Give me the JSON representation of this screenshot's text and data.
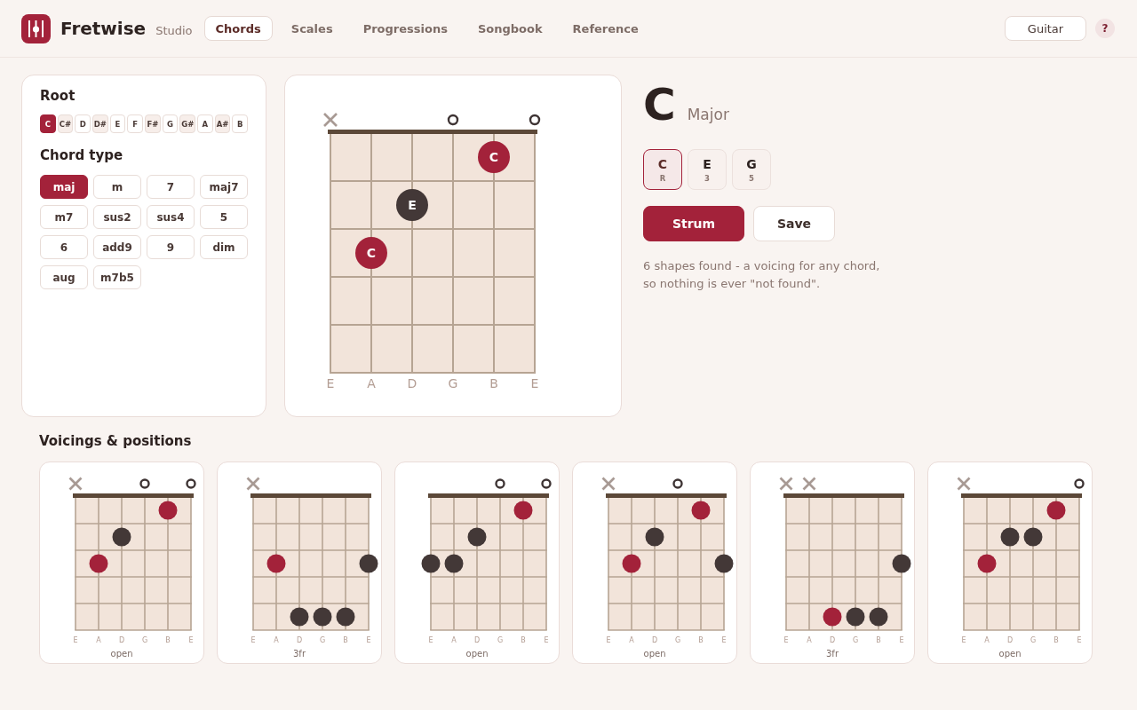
{
  "app": {
    "name": "Fretwise",
    "edition": "Studio"
  },
  "tabs": [
    {
      "label": "Chords",
      "selected": true
    },
    {
      "label": "Scales",
      "selected": false
    },
    {
      "label": "Progressions",
      "selected": false
    },
    {
      "label": "Songbook",
      "selected": false
    },
    {
      "label": "Reference",
      "selected": false
    }
  ],
  "instrument": {
    "label": "Guitar"
  },
  "help": {
    "label": "?"
  },
  "root_picker": {
    "title": "Root",
    "roots": [
      {
        "label": "C",
        "kind": "natural",
        "selected": true
      },
      {
        "label": "C#",
        "kind": "sharp",
        "selected": false
      },
      {
        "label": "D",
        "kind": "natural",
        "selected": false
      },
      {
        "label": "D#",
        "kind": "sharp",
        "selected": false
      },
      {
        "label": "E",
        "kind": "natural",
        "selected": false
      },
      {
        "label": "F",
        "kind": "natural",
        "selected": false
      },
      {
        "label": "F#",
        "kind": "sharp",
        "selected": false
      },
      {
        "label": "G",
        "kind": "natural",
        "selected": false
      },
      {
        "label": "G#",
        "kind": "sharp",
        "selected": false
      },
      {
        "label": "A",
        "kind": "natural",
        "selected": false
      },
      {
        "label": "A#",
        "kind": "sharp",
        "selected": false
      },
      {
        "label": "B",
        "kind": "natural",
        "selected": false
      }
    ]
  },
  "chord_type": {
    "title": "Chord type",
    "types": [
      {
        "label": "maj",
        "selected": true
      },
      {
        "label": "m",
        "selected": false
      },
      {
        "label": "7",
        "selected": false
      },
      {
        "label": "maj7",
        "selected": false
      },
      {
        "label": "m7",
        "selected": false
      },
      {
        "label": "sus2",
        "selected": false
      },
      {
        "label": "sus4",
        "selected": false
      },
      {
        "label": "5",
        "selected": false
      },
      {
        "label": "6",
        "selected": false
      },
      {
        "label": "add9",
        "selected": false
      },
      {
        "label": "9",
        "selected": false
      },
      {
        "label": "dim",
        "selected": false
      },
      {
        "label": "aug",
        "selected": false
      },
      {
        "label": "m7b5",
        "selected": false
      }
    ]
  },
  "diagram": {
    "strings": [
      {
        "label": "E",
        "muted": true,
        "open": false,
        "frets": [
          false,
          false,
          false,
          false,
          false
        ]
      },
      {
        "label": "A",
        "muted": false,
        "open": false,
        "frets": [
          false,
          false,
          true,
          false,
          false
        ],
        "color": "#a3223a",
        "note": "C"
      },
      {
        "label": "D",
        "muted": false,
        "open": false,
        "frets": [
          false,
          true,
          false,
          false,
          false
        ],
        "color": "#433837",
        "note": "E"
      },
      {
        "label": "G",
        "muted": false,
        "open": true,
        "frets": [
          false,
          false,
          false,
          false,
          false
        ]
      },
      {
        "label": "B",
        "muted": false,
        "open": false,
        "frets": [
          true,
          false,
          false,
          false,
          false
        ],
        "color": "#a3223a",
        "note": "C"
      },
      {
        "label": "E",
        "muted": false,
        "open": true,
        "frets": [
          false,
          false,
          false,
          false,
          false
        ]
      }
    ]
  },
  "chord": {
    "symbol": "C",
    "quality": "Major",
    "notes": [
      {
        "note": "C",
        "degree": "R",
        "selected": true
      },
      {
        "note": "E",
        "degree": "3",
        "selected": false
      },
      {
        "note": "G",
        "degree": "5",
        "selected": false
      }
    ],
    "actions": [
      {
        "label": "Strum",
        "kind": "primary"
      },
      {
        "label": "Save",
        "kind": "secondary"
      }
    ],
    "summary": "6 shapes found - a voicing for any chord, so nothing is ever \"not found\"."
  },
  "voicings": {
    "title": "Voicings & positions",
    "items": [
      {
        "position": "open",
        "strings": [
          {
            "label": "E",
            "muted": true,
            "open": false,
            "frets": [
              false,
              false,
              false,
              false,
              false
            ]
          },
          {
            "label": "A",
            "muted": false,
            "open": false,
            "frets": [
              false,
              false,
              true,
              false,
              false
            ],
            "color": "#a3223a"
          },
          {
            "label": "D",
            "muted": false,
            "open": false,
            "frets": [
              false,
              true,
              false,
              false,
              false
            ],
            "color": "#433837"
          },
          {
            "label": "G",
            "muted": false,
            "open": true,
            "frets": [
              false,
              false,
              false,
              false,
              false
            ]
          },
          {
            "label": "B",
            "muted": false,
            "open": false,
            "frets": [
              true,
              false,
              false,
              false,
              false
            ],
            "color": "#a3223a"
          },
          {
            "label": "E",
            "muted": false,
            "open": true,
            "frets": [
              false,
              false,
              false,
              false,
              false
            ]
          }
        ]
      },
      {
        "position": "3fr",
        "strings": [
          {
            "label": "E",
            "muted": true,
            "open": false,
            "frets": [
              false,
              false,
              false,
              false,
              false
            ]
          },
          {
            "label": "A",
            "muted": false,
            "open": false,
            "frets": [
              false,
              false,
              true,
              false,
              false
            ],
            "color": "#a3223a"
          },
          {
            "label": "D",
            "muted": false,
            "open": false,
            "frets": [
              false,
              false,
              false,
              false,
              true
            ],
            "color": "#433837"
          },
          {
            "label": "G",
            "muted": false,
            "open": false,
            "frets": [
              false,
              false,
              false,
              false,
              true
            ],
            "color": "#433837"
          },
          {
            "label": "B",
            "muted": false,
            "open": false,
            "frets": [
              false,
              false,
              false,
              false,
              true
            ],
            "color": "#433837"
          },
          {
            "label": "E",
            "muted": false,
            "open": false,
            "frets": [
              false,
              false,
              true,
              false,
              false
            ],
            "color": "#433837"
          }
        ]
      },
      {
        "position": "open",
        "strings": [
          {
            "label": "E",
            "muted": false,
            "open": false,
            "frets": [
              false,
              false,
              true,
              false,
              false
            ],
            "color": "#433837"
          },
          {
            "label": "A",
            "muted": false,
            "open": false,
            "frets": [
              false,
              false,
              true,
              false,
              false
            ],
            "color": "#433837"
          },
          {
            "label": "D",
            "muted": false,
            "open": false,
            "frets": [
              false,
              true,
              false,
              false,
              false
            ],
            "color": "#433837"
          },
          {
            "label": "G",
            "muted": false,
            "open": true,
            "frets": [
              false,
              false,
              false,
              false,
              false
            ]
          },
          {
            "label": "B",
            "muted": false,
            "open": false,
            "frets": [
              true,
              false,
              false,
              false,
              false
            ],
            "color": "#a3223a"
          },
          {
            "label": "E",
            "muted": false,
            "open": true,
            "frets": [
              false,
              false,
              false,
              false,
              false
            ]
          }
        ]
      },
      {
        "position": "open",
        "strings": [
          {
            "label": "E",
            "muted": true,
            "open": false,
            "frets": [
              false,
              false,
              false,
              false,
              false
            ]
          },
          {
            "label": "A",
            "muted": false,
            "open": false,
            "frets": [
              false,
              false,
              true,
              false,
              false
            ],
            "color": "#a3223a"
          },
          {
            "label": "D",
            "muted": false,
            "open": false,
            "frets": [
              false,
              true,
              false,
              false,
              false
            ],
            "color": "#433837"
          },
          {
            "label": "G",
            "muted": false,
            "open": true,
            "frets": [
              false,
              false,
              false,
              false,
              false
            ]
          },
          {
            "label": "B",
            "muted": false,
            "open": false,
            "frets": [
              true,
              false,
              false,
              false,
              false
            ],
            "color": "#a3223a"
          },
          {
            "label": "E",
            "muted": false,
            "open": false,
            "frets": [
              false,
              false,
              true,
              false,
              false
            ],
            "color": "#433837"
          }
        ]
      },
      {
        "position": "3fr",
        "strings": [
          {
            "label": "E",
            "muted": true,
            "open": false,
            "frets": [
              false,
              false,
              false,
              false,
              false
            ]
          },
          {
            "label": "A",
            "muted": true,
            "open": false,
            "frets": [
              false,
              false,
              false,
              false,
              false
            ]
          },
          {
            "label": "D",
            "muted": false,
            "open": false,
            "frets": [
              false,
              false,
              false,
              false,
              true
            ],
            "color": "#a3223a"
          },
          {
            "label": "G",
            "muted": false,
            "open": false,
            "frets": [
              false,
              false,
              false,
              false,
              true
            ],
            "color": "#433837"
          },
          {
            "label": "B",
            "muted": false,
            "open": false,
            "frets": [
              false,
              false,
              false,
              false,
              true
            ],
            "color": "#433837"
          },
          {
            "label": "E",
            "muted": false,
            "open": false,
            "frets": [
              false,
              false,
              true,
              false,
              false
            ],
            "color": "#433837"
          }
        ]
      },
      {
        "position": "open",
        "strings": [
          {
            "label": "E",
            "muted": true,
            "open": false,
            "frets": [
              false,
              false,
              false,
              false,
              false
            ]
          },
          {
            "label": "A",
            "muted": false,
            "open": false,
            "frets": [
              false,
              false,
              true,
              false,
              false
            ],
            "color": "#a3223a"
          },
          {
            "label": "D",
            "muted": false,
            "open": false,
            "frets": [
              false,
              true,
              false,
              false,
              false
            ],
            "color": "#433837"
          },
          {
            "label": "G",
            "muted": false,
            "open": false,
            "frets": [
              false,
              true,
              false,
              false,
              false
            ],
            "color": "#433837"
          },
          {
            "label": "B",
            "muted": false,
            "open": false,
            "frets": [
              true,
              false,
              false,
              false,
              false
            ],
            "color": "#a3223a"
          },
          {
            "label": "E",
            "muted": false,
            "open": true,
            "frets": [
              false,
              false,
              false,
              false,
              false
            ]
          }
        ]
      }
    ]
  }
}
